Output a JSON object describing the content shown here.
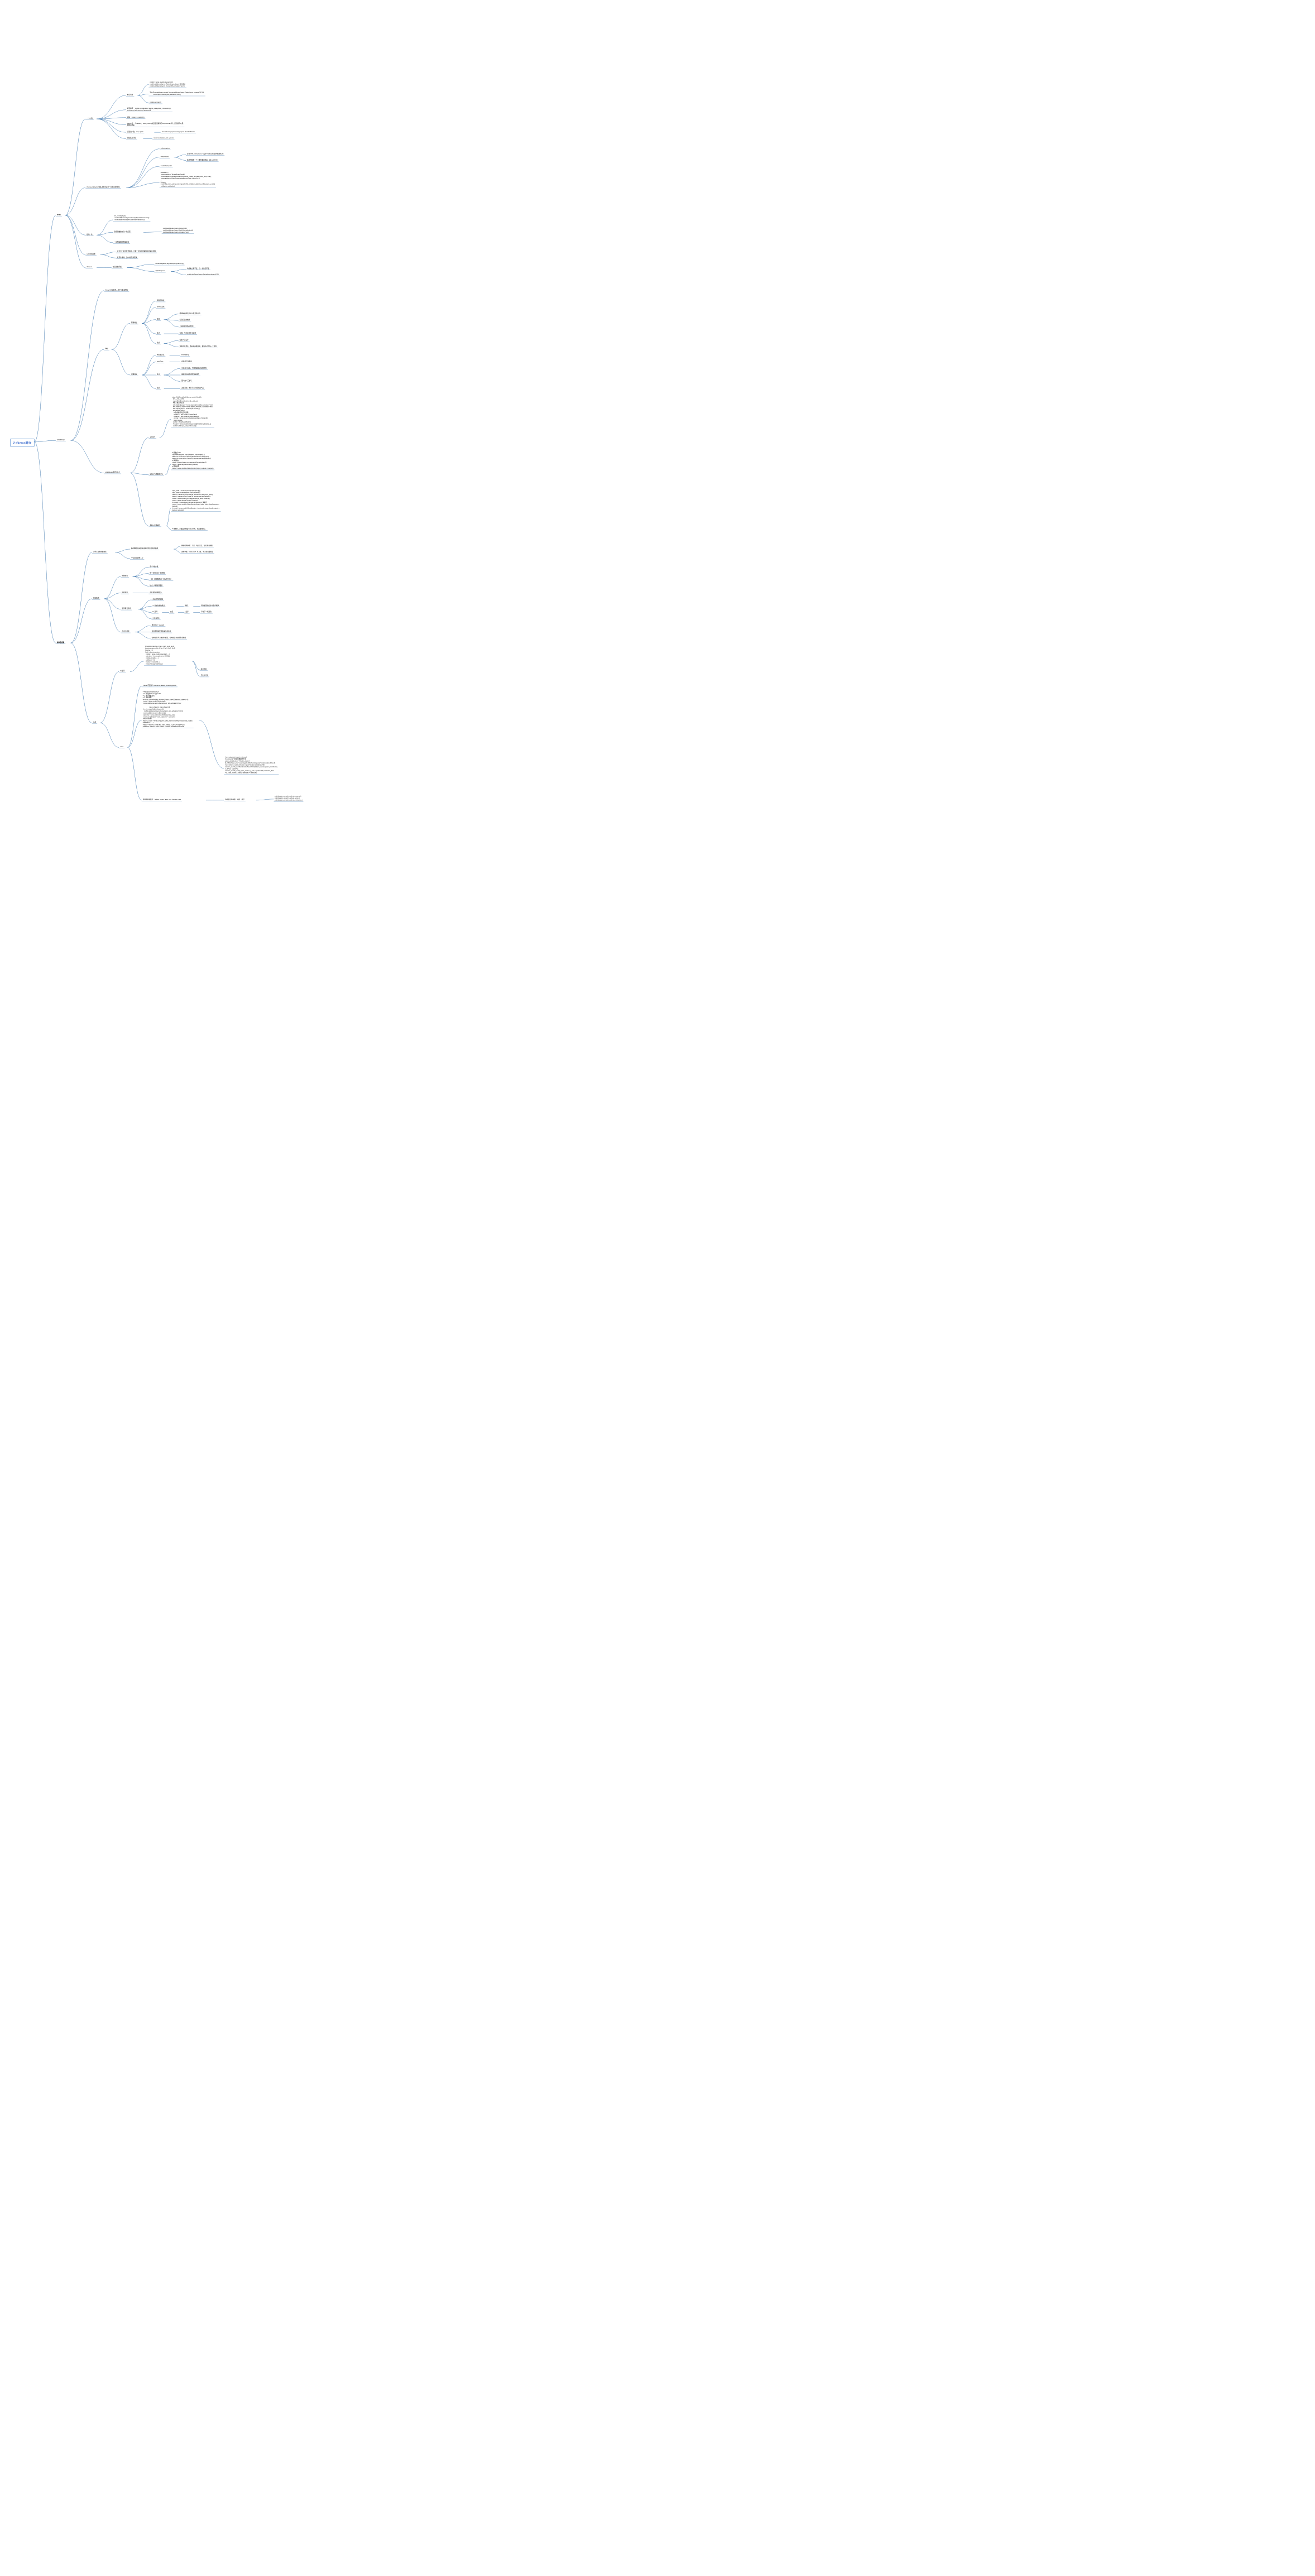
{
  "root": "2 tfkeras简介",
  "n": {
    "keras": "keras",
    "widedeep": "wide&deep",
    "hyper": "超参数搜索",
    "yige": "一个小例",
    "mxct": "模型创建",
    "mxct1": "model = keras.models.Sequential()\nmodel.add(keras.layers.Flatten(input_shape=[28,28]))\nmodel.add(keras.layers.Dense(300,activation='relu'))",
    "mxct2": "等价于model=keras.models.Sequential([keras.layers.Flatten(input_shape=[28,28]),\n         keras.layers.Dense(200,activation='relu')]",
    "mxct3": "model.summary()",
    "mxsp": "模型编译 ：model.compile(loss='sparse_categorical_crossentropy',\noptimizer='sgd',metrics=['accuracy'])",
    "xl": "训练：history = model.fit()",
    "hist": "history是一个callback，history.history成员变量保存了loss,accuracy等，然后就可以把\n图像画出来",
    "norm": "实现归一化：x=(x-u)/std",
    "norm1": "from sklearn.preprocessing import StandardScaler",
    "eval": "测试集上评估",
    "eval1": "model.evaluate(x_test, y_test)",
    "cbks": "tf.keras.callbacks(训练过程中进行一定程度的监听)",
    "early": "earlystopping",
    "tb": "tensorboard",
    "tb1": "命令行中：tensorbord --logdir=callbacks(文件夹的名字)",
    "tb2": "会给你提供一个人服务器的地址，如local:6006",
    "mcpt": "modelcheckpoint",
    "cbcode": "callbacks = [\n keras.callbacks.TensorBoard(logdir),\n keras.callbacks.ModelCheckpoing(output_model_file,save=best_only=True),\n keras.acllbacks.EarlyStopping(patience=5,min_delta=1e-3),\n]\nhistory=\nmodel.fit(x_train_cale,y_train,eppochs=10,validation_data=(x_valid_caced,y_valid)\n,callbacks=callbacks)",
    "bn": "批归一化",
    "bn1": "for _ in range(20):\n model.add(keras.layers.Dense(100,activation='relu'))\n model.add(keras.layers.BatchNormalization())",
    "bn2": "激活函数放在归一化后面",
    "bn2a": "model.add(keras.layers.Dense(100))\nmodel.add(keras.layers.BatchNormalization())\nmodel.add(keras.layers.Activation('relu')",
    "bn3": "一定程度缓解梯度消失",
    "selu": "selu激活函数",
    "selu1": "自带归一化的激活函数，也能一定程度缓解梯度消失的问题",
    "selu2": "效果非常好，比BN效果好很多",
    "drop": "dropout",
    "drop1": "在层之前添加",
    "drop1a": "model.add(keras.layers.Dropout(rate=0.5))",
    "drop2": "AlphaDropout",
    "drop2a": "均值和方差不变，归一化性质不变",
    "drop2b": "model.add(keras.layers.Alphadropout(rate=0.5))",
    "wd1": "Google16年发布，用于分类和回归",
    "tz": "特征",
    "xs": "稀疏特征",
    "mj": "密集特征",
    "lsw": "离散值特征",
    "oh": "onehot表示",
    "jc": "交叉",
    "jc1": "稀疏特征做交叉可以取并集信息",
    "jc2": "实现记忆的效果",
    "jc3": "（其实就是特征交叉）",
    "yd": "优点",
    "yd1": "有效，广泛应用于工业界",
    "qd": "缺点",
    "qd1": "需要人工设计",
    "qd2": "可能过于契合，所有特征做交叉，相当于记住每一个样本",
    "mj1": "用向量表达",
    "mj1a": "embedding",
    "mj2": "word2vec",
    "mj2a": "查表词汇到距离",
    "mjyd": "优点",
    "mjyd1": "带有语义信息，不同向量之间有相关性",
    "mjyd2": "兼容没有出现过的特征组合",
    "mjyd3": "更少的人工参与",
    "mjqd": "缺点",
    "mjqd1": "过度泛化，推荐不怎么相关的产品",
    "wdz": "wide&deep模型知识点",
    "sub": "子类API",
    "subcode": "class WideDeepModel(keras.models.Model):\n  def __init__(self)\n  super(SideDeepModel,self).__init__()\n  #定义模型的层次\n  self.hidden1_layer = keras.layers.Dense(30, activation='relu')\n  self.hidden2_layer = keras.layers.Dense(30, activation='relu')\n  self.output_layer =  keras.layer.Dense(1)\n  def call(self,input):\n    # 完成模型的正向运算\n    hidden1 = self.hidden1_layer(input)\n    hidden2 = self.hidden2_layer(hidden1)\n    concat = keras.layers.concatenate([input, hidden2])\n    return output\n  model = WideDeepModel()\n  # model = deras.models.Sequential([WideDeepModel(), ])\n  model.build(input_shape=(None,8))",
    "fapi": "功能API(函数式API)",
    "fapicode": "# 函数式 API\ninput=keras.layers.Input(shape=x_train.shape[1:])\nhidden1= keras.layers.Dense(30,activation='relu')(input)\nhidden2= keras.layers.Dense(30,activation='relu')(hidden1)\n# 拼接输入\nconcat = keras.layers.concatenate()([input,hidden2])\noutput = keras.layers.Dense(1)(concat)\n# 固化模型\nmodel = keras.models.Model(inputs=[input], outputs = [output])",
    "mimo": "多输入和多输出",
    "mimocode": "input_wide = keras.layers.Input(shape=[5])\ninput_deep = keras.layers.Input(shpre=[6])\nhidden1 = keras.layer.Dense(30, activation='relu)(input_deep))\nhidden2 = keras.layer.Dense(30, activation='relu)(hidden1)\nconcat = keras.layers.concatenate([input_wide, hidden2])\noutput = keras.layers.Dense(1)(concat)\n# output2 = keras.layers.Dense(1)(hidden2) # 多输出\nmodel = keras.models.Model(inputs=[input_wide, input_deep],outputs =\n[output])\n# model= keras.model.Model(inputs = input_wide,input_deep], outputs =\n[output, outputs2])",
    "mimo2": "# 预测时，多输出也例如evaluate中，也需要两份y。",
    "why": "为什么要超参数搜索",
    "why1": "精调网络中有很多训练过程中不变的参数",
    "why1a": "网络结构参数：几层，每层宽度，每层激活函数",
    "why1b": "训练参数：batch_size, 学习率，学习率衰减算法",
    "why2": "手工尝试消费人力",
    "ss": "搜索策略",
    "wg": "网格搜索",
    "wg1": "定义n维方格",
    "wg2": "每个方格对应一组参数",
    "wg3": "一组一组参数测试（可以并行化）",
    "wg4": "缺点: 只能取预设值",
    "rs": "随机搜索",
    "rs1": "替代值取可能很多",
    "ga": "遗传算法搜索",
    "ga1": "对自然界的模拟",
    "ga2": "A. 初始化参数集合",
    "ga2a": "训练",
    "ga2b": "得到模型指标作为生存概率",
    "ga3": "B. 选择",
    "ga3a": "交叉",
    "ga3b": "变异",
    "ga3c": "产生下一代集合",
    "ga4": "C.重新到A",
    "qf": "启发式搜索",
    "qf1": "研究热点！AutoML",
    "qf2": "使用循环神经网络来生成参数",
    "qf3": "使用强化学习来进行反馈，使用模型来训练生成参数",
    "sz": "实战",
    "for": "for循环",
    "forcode": "# learning rate [1e-4, 3e-4, 1e-3, 1e-2, 3e-2]\nlearning_rates = [1e-4, 3e-4, 1e-3, 1e-2, 3e-2]\nhistorys = []\nfor lr in learning_rates:\n  model = keras.model.squential(......)\n  optmizer = keras.optimizers.SGD(lr)\n  model.compile(,...,)\n  callbacks = []\n  history = model.fit(...)\n  historyes.append(history)",
    "for1": "简单粗暴",
    "for2": "无法并行化",
    "sk": "scikit",
    "sk1": "tf.keras下面有个wrappers, sklearn,KerasRegressor",
    "skcode": "# RandomizedSearchCV\n# 1. 转化为sklearn 的model\n# 2. 定义参数集合\n# 3. 搜索函数\ndef build_model(hidden_layers=1, layer_size=30,learning_rate=1e-3):\n model = keras.model.Sequential()\n model.add(keras.layers.Dense(layer_size,activation='relu',\n\n                input_shape=x_train.shape[1:]))\n for _ in range(hidden_layers-1):\n   model.add(keras.layers.Dense(layer_size,activation='relu'))\n model.add(keras.layers.Dense(1))\n optimizer = keras.optimizers.SGD(learning_rate)\n model.compile(loss='mse', optimizer = optimizer)\n return model\nsklearn_model = keras.wrappers.scikit_learn.KerasRegressor(build_model)\ncallbacks = [......]\nhistory = sklearn_model.fit(x_train_scaled, y_train, epochs=100,\nvalidation_data=(x_valid_scaled, y_valid), callbacks=callbacks)",
    "skp": "from scipy.stats import reciprocal\n# reciprocal一种生成数据的方式\nparam_distributions={\"hidden_layers\":\n[1,2,3,4],\"layer_size\":np.arange(1,100),\"learning_rate\":reciprocal(1e-4,1e-2)}\nfrom sklearn.model_selection import RandomizedSearchVB\nrandom_search_cv =RandomizedSearchCV(sklearn_model, param_distribution,\nn_ite=10, n_jobs=1)\nrandom_search_cv.fit(x_train_scaled, y_train, epochs=100,validation_data\n=(x_valid_scaled,y_valid), callbacks = callbacks)",
    "skr": "要搜索的参数是：hidden_layers, layer_sice, learning_rate",
    "skr1": "查看最后的参数、分数、模型",
    "skr2": "print(random_search_cv.best_params_)\nprint(random_search_cv.best_score_)\nprint(random_search_cv.best_estimator_)"
  }
}
